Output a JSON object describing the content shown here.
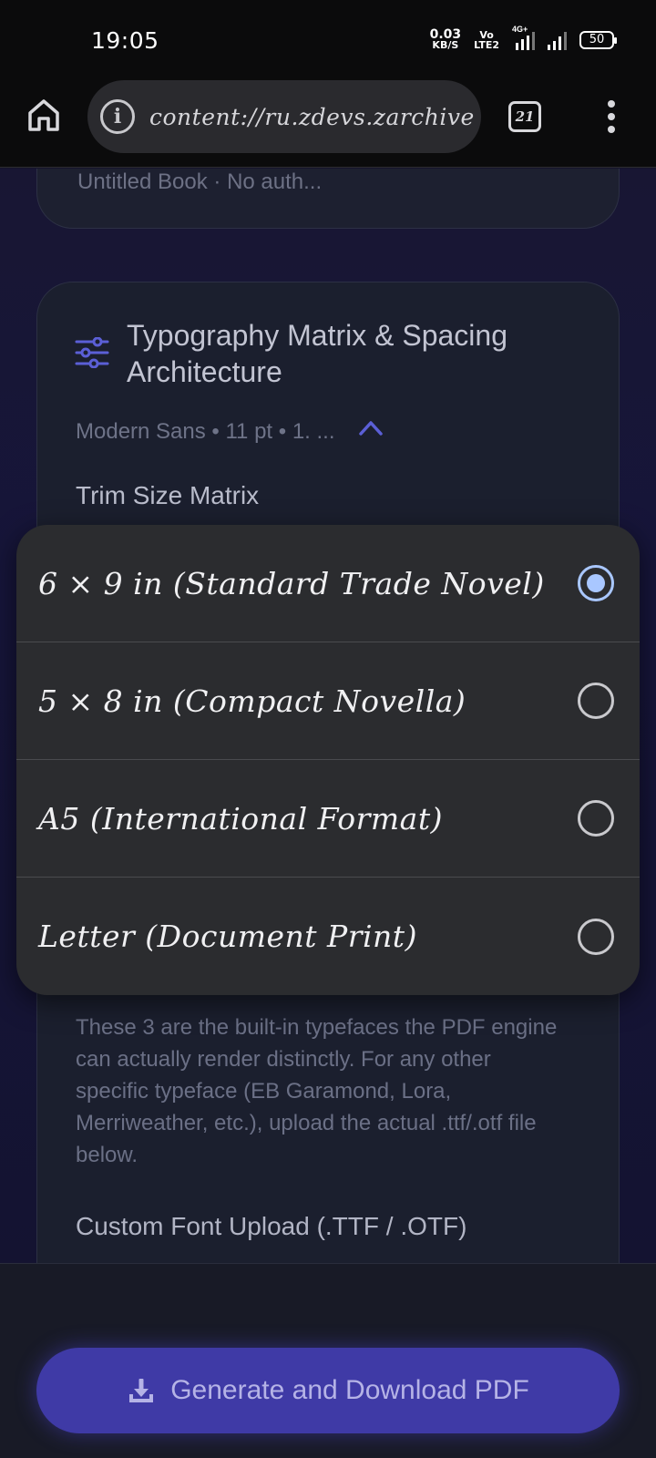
{
  "status_bar": {
    "time": "19:05",
    "net_speed_value": "0.03",
    "net_speed_unit": "KB/S",
    "volte_top": "Vo",
    "volte_bottom": "LTE2",
    "network_type": "4G+",
    "battery": "50"
  },
  "browser": {
    "url": "content://ru.zdevs.zarchive",
    "tab_count": "21"
  },
  "prev_card": {
    "partial_text": "Untitled Book · No auth..."
  },
  "typography_card": {
    "title": "Typography Matrix & Spacing Architecture",
    "summary": "Modern Sans • 11 pt • 1. ...",
    "trim_size_label": "Trim Size Matrix",
    "help_text": "These 3 are the built-in typefaces the PDF engine can actually render distinctly. For any other specific typeface (EB Garamond, Lora, Merriweather, etc.), upload the actual .ttf/.otf file below.",
    "upload_label": "Custom Font Upload (.TTF / .OTF)"
  },
  "trim_size_options": [
    {
      "label": "6 × 9 in (Standard Trade Novel)",
      "selected": true
    },
    {
      "label": "5 × 8 in (Compact Novella)",
      "selected": false
    },
    {
      "label": "A5 (International Format)",
      "selected": false
    },
    {
      "label": "Letter (Document Print)",
      "selected": false
    }
  ],
  "generate_button": {
    "label": "Generate and Download PDF"
  },
  "colors": {
    "accent": "#3f3aa6",
    "radio_selected": "#a9c7ff",
    "icon_accent": "#5b5fd6"
  }
}
